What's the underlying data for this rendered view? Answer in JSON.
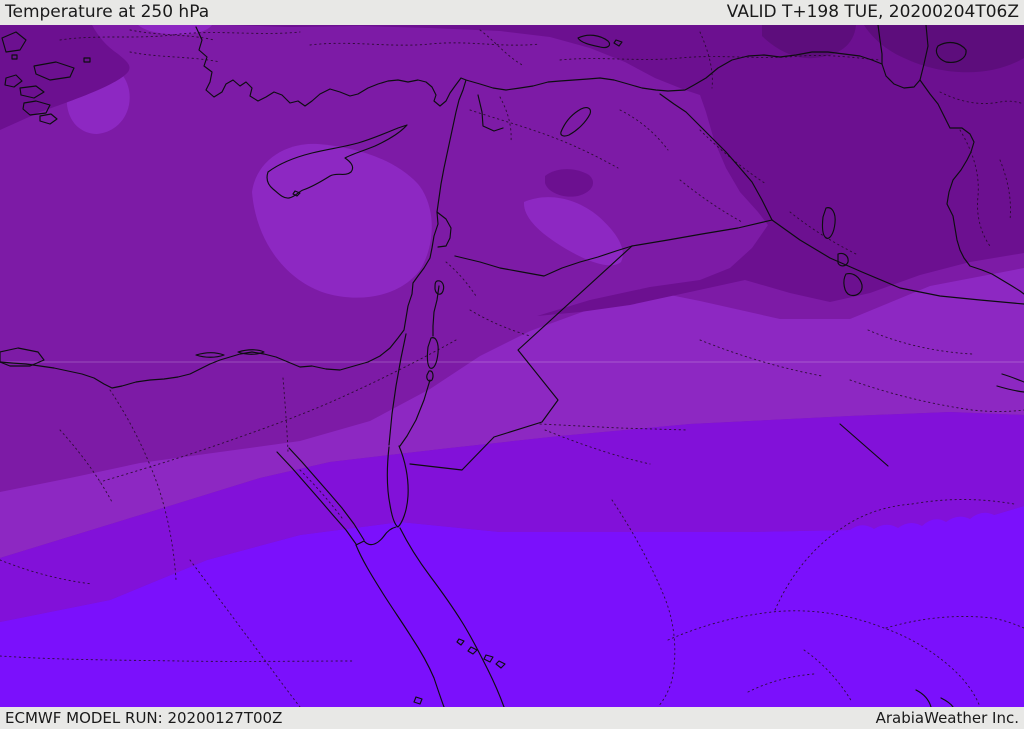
{
  "header": {
    "title": "Temperature at 250 hPa",
    "valid_time": "VALID T+198 TUE, 20200204T06Z"
  },
  "footer": {
    "model_run": "ECMWF MODEL RUN: 20200127T00Z",
    "brand": "ArabiaWeather Inc."
  },
  "map": {
    "kind": "filled contour temperature map",
    "region": "Eastern Mediterranean / Middle East",
    "bands": [
      {
        "id": "band-coldest",
        "color": "#5d0d7c"
      },
      {
        "id": "band-cold",
        "color": "#6c1090"
      },
      {
        "id": "band-main",
        "color": "#7d1ba6"
      },
      {
        "id": "band-mild",
        "color": "#8d28c2"
      },
      {
        "id": "band-warm",
        "color": "#8211d9"
      },
      {
        "id": "band-warmest",
        "color": "#7b10fc"
      }
    ],
    "line_colors": {
      "coastline": "#0d0d10",
      "admin_dotted": "#240a28"
    },
    "chrome_bg": "#e8e8e6",
    "text_color": "#1a1a1a"
  }
}
